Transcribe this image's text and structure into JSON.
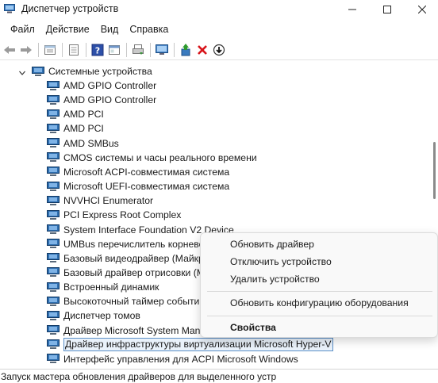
{
  "window": {
    "title": "Диспетчер устройств"
  },
  "menu": [
    "Файл",
    "Действие",
    "Вид",
    "Справка"
  ],
  "toolbar": {
    "icons": [
      "back-icon",
      "forward-icon",
      "properties-icon",
      "update-driver-icon",
      "help-icon",
      "view-icon",
      "print-icon",
      "monitor-icon",
      "enable-device-icon",
      "uninstall-icon",
      "download-icon"
    ]
  },
  "tree": {
    "category": "Системные устройства",
    "devices": [
      "AMD GPIO Controller",
      "AMD GPIO Controller",
      "AMD PCI",
      "AMD PCI",
      "AMD SMBus",
      "CMOS системы и часы реального времени",
      "Microsoft ACPI-совместимая система",
      "Microsoft UEFI-совместимая система",
      "NVVHCI Enumerator",
      "PCI Express Root Complex",
      "System Interface Foundation V2 Device",
      "UMBus перечислитель корнево",
      "Базовый видеодрайвер (Майкр",
      "Базовый драйвер отрисовки (М",
      "Встроенный динамик",
      "Высокоточный таймер событи",
      "Диспетчер томов",
      "Драйвер Microsoft System Mana",
      "Драйвер инфраструктуры виртуализации Microsoft Hyper-V",
      "Интерфейс управления для ACPI Microsoft Windows"
    ],
    "selected_index": 18
  },
  "context_menu": {
    "update_driver": "Обновить драйвер",
    "disable_device": "Отключить устройство",
    "uninstall_device": "Удалить устройство",
    "scan_hardware": "Обновить конфигурацию оборудования",
    "properties": "Свойства"
  },
  "status": {
    "text": "Запуск мастера обновления драйверов для выделенного устр"
  }
}
